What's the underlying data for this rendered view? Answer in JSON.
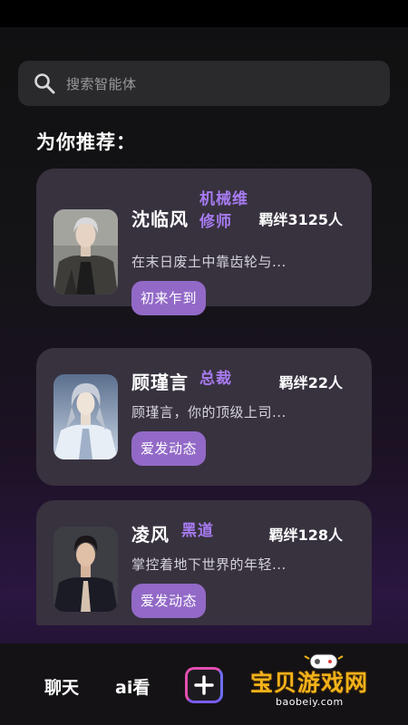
{
  "search": {
    "placeholder": "搜索智能体",
    "icon": "search-icon"
  },
  "section": {
    "title": "为你推荐："
  },
  "cards": [
    {
      "name": "沈临风",
      "tag_line1": "机械维",
      "tag_line2": "修师",
      "bond": "羁绊3125人",
      "desc": "在末日废土中靠齿轮与...",
      "button": "初来乍到",
      "avatar": "avatar-man-leather-jacket"
    },
    {
      "name": "顾瑾言",
      "tag": "总裁",
      "bond": "羁绊22人",
      "desc": "顾瑾言，你的顶级上司...",
      "button": "爱发动态",
      "avatar": "avatar-man-silver-hair"
    },
    {
      "name": "凌风",
      "tag": "黑道",
      "bond": "羁绊128人",
      "desc": "掌控着地下世界的年轻...",
      "button": "爱发动态",
      "avatar": "avatar-man-dark-suit"
    }
  ],
  "nav": {
    "chat": "聊天",
    "ai_watch": "ai看",
    "add_icon": "plus-icon"
  },
  "watermark": {
    "text": "宝贝游戏网",
    "url": "baobeiy.com"
  },
  "colors": {
    "accent_purple": "#a77bf0",
    "button_purple": "#9269c7",
    "card_bg": "#38323f",
    "watermark_gold": "#f2b21a"
  }
}
